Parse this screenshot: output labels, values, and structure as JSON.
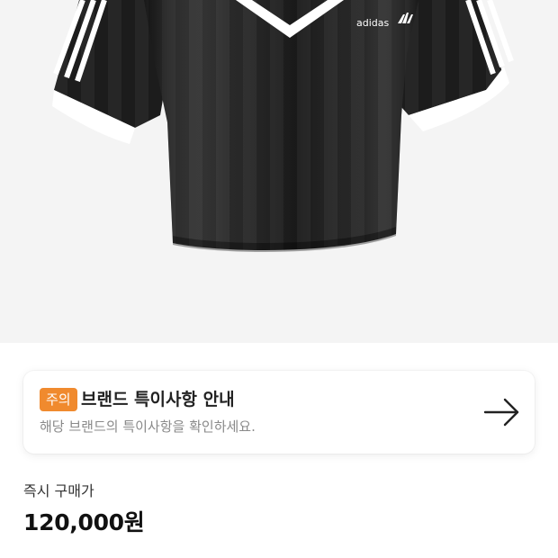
{
  "product_image": {
    "alt_semantic": "black cropped v-neck jersey tee with white three stripes",
    "brand_logo_text": "adidas",
    "colors": {
      "background": "#f4f4f4",
      "garment": "#1c1c1c",
      "trim": "#ffffff"
    }
  },
  "notice": {
    "badge": "주의",
    "title": "브랜드 특이사항 안내",
    "description": "해당 브랜드의 특이사항을 확인하세요.",
    "arrow_icon": "arrow-right-icon",
    "badge_color": "#f08a2e"
  },
  "price": {
    "label": "즉시 구매가",
    "value": "120,000원"
  }
}
